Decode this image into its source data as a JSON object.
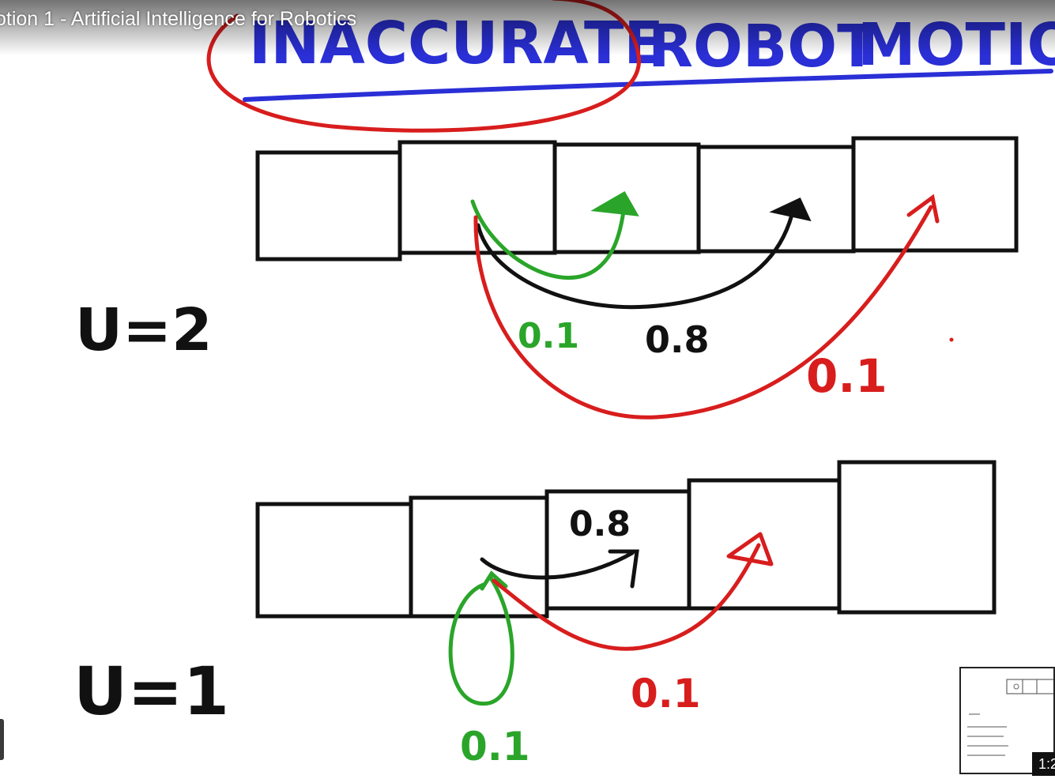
{
  "video": {
    "title": "otion 1 - Artificial Intelligence for Robotics",
    "preview_time": "1:2"
  },
  "whiteboard": {
    "heading": {
      "word1": "INACCURATE",
      "word2": "ROBOT",
      "word3": "MOTION"
    },
    "scenario_top": {
      "label": "U=2",
      "cell_count": 5,
      "prob_under": "0.1",
      "prob_exact": "0.8",
      "prob_over": "0.1"
    },
    "scenario_bottom": {
      "label": "U=1",
      "cell_count": 5,
      "prob_under": "0.1",
      "prob_exact": "0.8",
      "prob_over": "0.1"
    }
  },
  "colors": {
    "heading_blue": "#2a2fd6",
    "circle_red": "#d81d1d",
    "green": "#2aa52a",
    "black": "#111111",
    "red": "#d81d1d"
  },
  "icons": {
    "seek_handle": "seek-handle-icon"
  }
}
